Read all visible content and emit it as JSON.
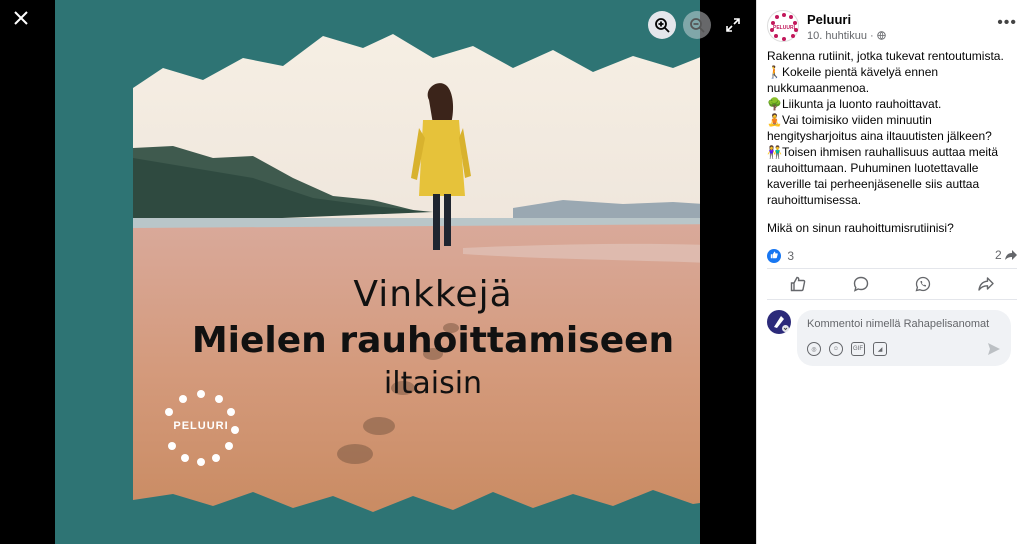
{
  "viewer": {
    "close_icon": "close-icon",
    "zoom_in_icon": "zoom-in-icon",
    "zoom_out_icon": "zoom-out-icon",
    "expand_icon": "expand-icon"
  },
  "image": {
    "headline_line1": "Vinkkejä",
    "headline_line2": "Mielen rauhoittamiseen",
    "headline_line3": "iltaisin",
    "logo_text": "PELUURI",
    "background_color": "#2e7474"
  },
  "post": {
    "page_name": "Peluuri",
    "date": "10. huhtikuu",
    "audience_icon": "globe-icon",
    "more_label": "•••",
    "paragraphs": [
      "Rakenna rutiinit, jotka tukevat rentoutumista.",
      "🚶Kokeile pientä kävelyä ennen nukkumaanmenoa.",
      "🌳Liikunta ja luonto rauhoittavat.",
      "🧘Vai toimisiko viiden minuutin hengitysharjoitus aina iltauutisten jälkeen?",
      "👫Toisen ihmisen rauhallisuus auttaa meitä rauhoittumaan. Puhuminen luotettavalle kaverille tai perheenjäsenelle siis auttaa rauhoittumisessa.",
      "",
      "Mikä on sinun rauhoittumisrutiinisi?"
    ],
    "like_count": "3",
    "share_count": "2",
    "like_color": "#1877f2"
  },
  "comment": {
    "placeholder": "Kommentoi nimellä Rahapelisanomat"
  }
}
